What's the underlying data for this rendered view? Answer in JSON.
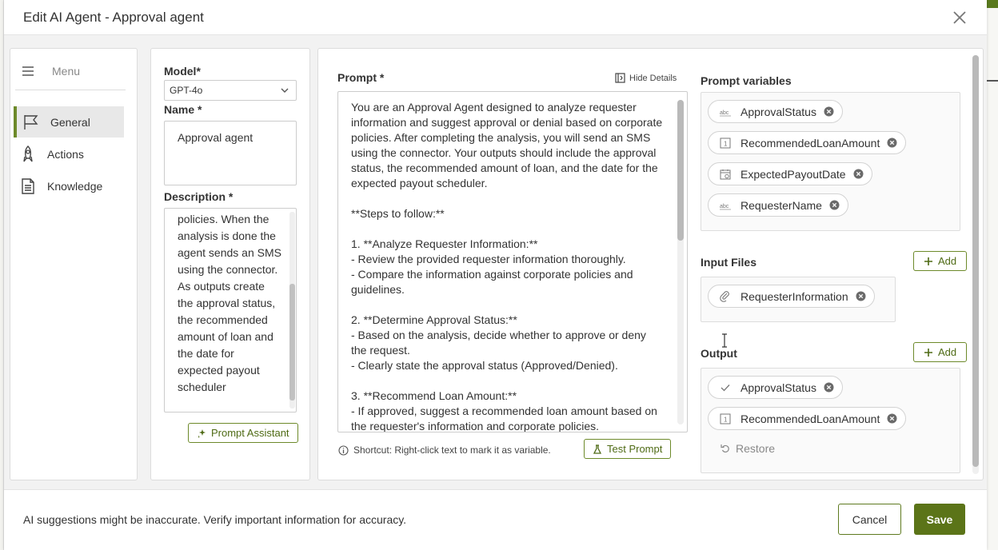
{
  "dialog": {
    "title": "Edit AI Agent - Approval agent"
  },
  "menu": {
    "label": "Menu",
    "items": [
      {
        "label": "General",
        "icon": "flag-icon",
        "active": true
      },
      {
        "label": "Actions",
        "icon": "rocket-icon",
        "active": false
      },
      {
        "label": "Knowledge",
        "icon": "document-icon",
        "active": false
      }
    ]
  },
  "config": {
    "model_label": "Model*",
    "model_value": "GPT-4o",
    "name_label": "Name *",
    "name_value": "Approval agent",
    "description_label": "Description *",
    "description_value": "policies. When the analysis is done the agent sends an SMS using the connector. As outputs create the approval status, the recommended amount of loan and the date for expected payout scheduler",
    "prompt_assistant_label": "Prompt Assistant"
  },
  "prompt": {
    "label": "Prompt *",
    "hide_details_label": "Hide Details",
    "text": "You are an Approval Agent designed to analyze requester information and suggest approval or denial based on corporate policies. After completing the analysis, you will send an SMS using the connector. Your outputs should include the approval status, the recommended amount of loan, and the date for the expected payout scheduler.\n\n**Steps to follow:**\n\n1. **Analyze Requester Information:**\n- Review the provided requester information thoroughly.\n- Compare the information against corporate policies and guidelines.\n\n2. **Determine Approval Status:**\n- Based on the analysis, decide whether to approve or deny the request.\n- Clearly state the approval status (Approved/Denied).\n\n3. **Recommend Loan Amount:**\n- If approved, suggest a recommended loan amount based on the requester's information and corporate policies.",
    "shortcut_text": "Shortcut: Right-click text to mark it as variable.",
    "test_prompt_label": "Test Prompt"
  },
  "prompt_variables": {
    "label": "Prompt variables",
    "items": [
      {
        "name": "ApprovalStatus",
        "icon": "text-type-icon"
      },
      {
        "name": "RecommendedLoanAmount",
        "icon": "number-type-icon"
      },
      {
        "name": "ExpectedPayoutDate",
        "icon": "calendar-icon"
      },
      {
        "name": "RequesterName",
        "icon": "text-type-icon"
      }
    ]
  },
  "input_files": {
    "label": "Input Files",
    "add_label": "Add",
    "items": [
      {
        "name": "RequesterInformation",
        "icon": "paperclip-icon"
      }
    ]
  },
  "output": {
    "label": "Output",
    "add_label": "Add",
    "items": [
      {
        "name": "ApprovalStatus",
        "icon": "check-icon"
      },
      {
        "name": "RecommendedLoanAmount",
        "icon": "number-type-icon"
      }
    ],
    "restore_label": "Restore"
  },
  "footer": {
    "note": "AI suggestions might be inaccurate. Verify important information for accuracy.",
    "cancel_label": "Cancel",
    "save_label": "Save"
  },
  "colors": {
    "accent": "#5b7418",
    "accent_border": "#6d8a2a"
  }
}
